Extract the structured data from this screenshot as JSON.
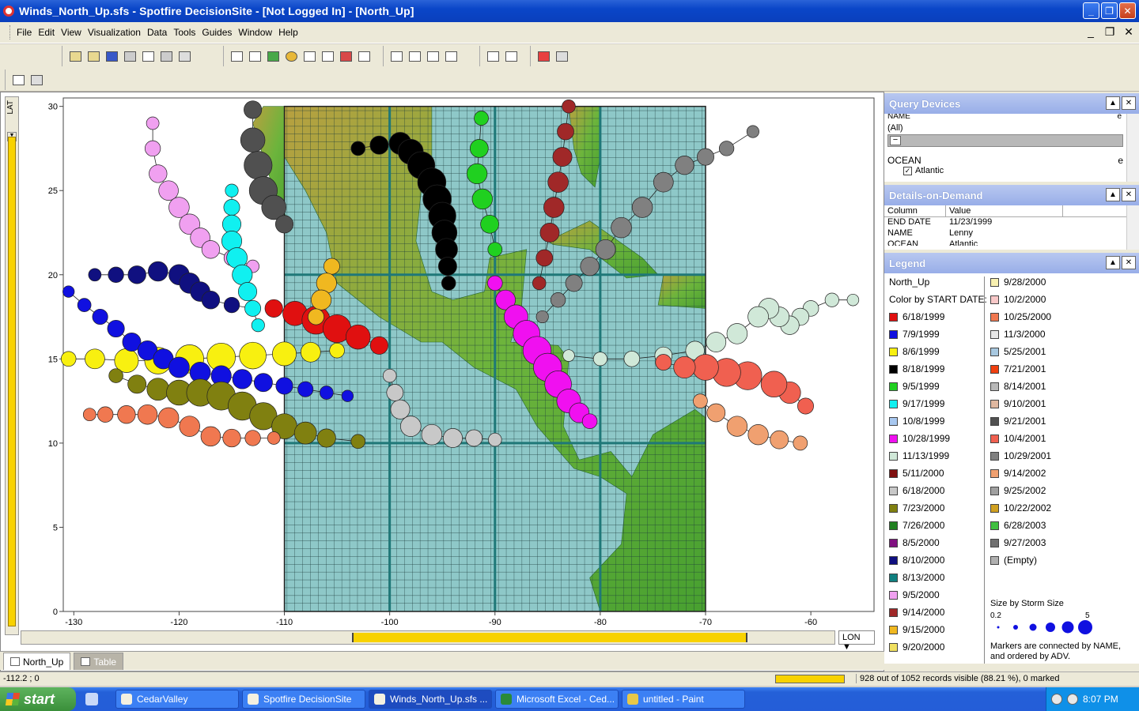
{
  "window": {
    "title": "Winds_North_Up.sfs - Spotfire DecisionSite - [Not Logged In] - [North_Up]",
    "minimize": "_",
    "maximize": "❐",
    "close": "✕"
  },
  "menu": [
    "File",
    "Edit",
    "View",
    "Visualization",
    "Data",
    "Tools",
    "Guides",
    "Window",
    "Help"
  ],
  "mdi": {
    "minimize": "_",
    "restore": "❐",
    "close": "✕"
  },
  "lat_label": "LAT",
  "lon_label": "LON ▼",
  "axes": {
    "x_ticks": [
      "-130",
      "-120",
      "-110",
      "-100",
      "-90",
      "-80",
      "-70",
      "-60"
    ],
    "y_ticks": [
      "30",
      "25",
      "20",
      "15",
      "10",
      "5",
      "0"
    ],
    "xlim": [
      -131,
      -54
    ],
    "ylim": [
      0,
      30.5
    ]
  },
  "tabs": [
    {
      "label": "North_Up",
      "active": true
    },
    {
      "label": "Table",
      "active": false
    }
  ],
  "query_devices": {
    "title": "Query Devices",
    "name_label": "NAME",
    "name_value": "(All)",
    "ocean_label": "OCEAN",
    "ocean_value": "Atlantic",
    "ocean_flag": "e",
    "name_flag": "e"
  },
  "details": {
    "title": "Details-on-Demand",
    "col_header": "Column",
    "val_header": "Value",
    "rows": [
      {
        "col": "END DATE",
        "val": "11/23/1999"
      },
      {
        "col": "NAME",
        "val": "Lenny"
      },
      {
        "col": "OCEAN",
        "val": "Atlantic"
      }
    ]
  },
  "legend": {
    "title": "Legend",
    "heading": "North_Up",
    "color_by": "Color by START DATE:",
    "col1": [
      {
        "label": "6/18/1999",
        "color": "#e01010"
      },
      {
        "label": "7/9/1999",
        "color": "#1010e0"
      },
      {
        "label": "8/6/1999",
        "color": "#f8f010"
      },
      {
        "label": "8/18/1999",
        "color": "#000000"
      },
      {
        "label": "9/5/1999",
        "color": "#20d020"
      },
      {
        "label": "9/17/1999",
        "color": "#10f0f0"
      },
      {
        "label": "10/8/1999",
        "color": "#a8c8f0"
      },
      {
        "label": "10/28/1999",
        "color": "#f010f0"
      },
      {
        "label": "11/13/1999",
        "color": "#d0e8d8"
      },
      {
        "label": "5/11/2000",
        "color": "#801010"
      },
      {
        "label": "6/18/2000",
        "color": "#c8c8c8"
      },
      {
        "label": "7/23/2000",
        "color": "#808010"
      },
      {
        "label": "7/26/2000",
        "color": "#208020"
      },
      {
        "label": "8/5/2000",
        "color": "#801080"
      },
      {
        "label": "8/10/2000",
        "color": "#101080"
      },
      {
        "label": "8/13/2000",
        "color": "#108080"
      },
      {
        "label": "9/5/2000",
        "color": "#f0a0f0"
      },
      {
        "label": "9/14/2000",
        "color": "#a02828"
      },
      {
        "label": "9/15/2000",
        "color": "#f0b820"
      },
      {
        "label": "9/20/2000",
        "color": "#f0e060"
      }
    ],
    "col2": [
      {
        "label": "9/28/2000",
        "color": "#f8f0b0"
      },
      {
        "label": "10/2/2000",
        "color": "#f8c8c8"
      },
      {
        "label": "10/25/2000",
        "color": "#f07850"
      },
      {
        "label": "11/3/2000",
        "color": "#e8e8e8"
      },
      {
        "label": "5/25/2001",
        "color": "#a8c8e0"
      },
      {
        "label": "7/21/2001",
        "color": "#f04010"
      },
      {
        "label": "8/14/2001",
        "color": "#b8b8b8"
      },
      {
        "label": "9/10/2001",
        "color": "#e0b8a0"
      },
      {
        "label": "9/21/2001",
        "color": "#505050"
      },
      {
        "label": "10/4/2001",
        "color": "#f06050"
      },
      {
        "label": "10/29/2001",
        "color": "#808080"
      },
      {
        "label": "9/14/2002",
        "color": "#f0a070"
      },
      {
        "label": "9/25/2002",
        "color": "#a0a0a0"
      },
      {
        "label": "10/22/2002",
        "color": "#d0a020"
      },
      {
        "label": "6/28/2003",
        "color": "#40c040"
      },
      {
        "label": "9/27/2003",
        "color": "#707070"
      },
      {
        "label": "(Empty)",
        "color": "#b0b0b0"
      }
    ],
    "size_by": "Size by Storm Size",
    "size_min": "0.2",
    "size_max": "5",
    "note": "Markers are connected by NAME, and ordered by ADV."
  },
  "status": {
    "coords": "-112.2 ; 0",
    "records": "928 out of 1052 records visible (88.21 %), 0 marked"
  },
  "taskbar": {
    "start": "start",
    "buttons": [
      "CedarValley",
      "Spotfire DecisionSite",
      "Winds_North_Up.sfs ...",
      "Microsoft Excel - Ced...",
      "untitled - Paint"
    ],
    "active_index": 2,
    "clock": "8:07 PM"
  },
  "chart_data": {
    "type": "scatter",
    "xlim": [
      -131,
      -54
    ],
    "ylim": [
      0,
      30.5
    ],
    "grid": false,
    "map_extent": {
      "lon": [
        -110,
        -70
      ],
      "lat": [
        0,
        30
      ]
    },
    "series": [
      {
        "color": "#f8f010",
        "points": [
          [
            -130.5,
            15
          ],
          [
            -128,
            15
          ],
          [
            -125,
            14.9
          ],
          [
            -122,
            14.9
          ],
          [
            -119,
            15
          ],
          [
            -116,
            15.1
          ],
          [
            -113,
            15.2
          ],
          [
            -110,
            15.3
          ],
          [
            -107.5,
            15.4
          ],
          [
            -105,
            15.5
          ]
        ]
      },
      {
        "color": "#1010e0",
        "points": [
          [
            -130.5,
            19
          ],
          [
            -129,
            18.2
          ],
          [
            -127.5,
            17.5
          ],
          [
            -126,
            16.8
          ],
          [
            -124.5,
            16
          ],
          [
            -123,
            15.5
          ],
          [
            -121.5,
            15
          ],
          [
            -120,
            14.5
          ],
          [
            -118,
            14.2
          ],
          [
            -116,
            14
          ],
          [
            -114,
            13.8
          ],
          [
            -112,
            13.6
          ],
          [
            -110,
            13.4
          ],
          [
            -108,
            13.2
          ],
          [
            -106,
            13
          ],
          [
            -104,
            12.8
          ]
        ]
      },
      {
        "color": "#101080",
        "points": [
          [
            -128,
            20
          ],
          [
            -126,
            20
          ],
          [
            -124,
            20
          ],
          [
            -122,
            20.2
          ],
          [
            -120,
            20
          ],
          [
            -119,
            19.5
          ],
          [
            -118,
            19
          ],
          [
            -117,
            18.5
          ],
          [
            -115,
            18.2
          ],
          [
            -113,
            18
          ]
        ]
      },
      {
        "color": "#808010",
        "points": [
          [
            -126,
            14
          ],
          [
            -124,
            13.5
          ],
          [
            -122,
            13.2
          ],
          [
            -120,
            13
          ],
          [
            -118,
            13
          ],
          [
            -116,
            12.8
          ],
          [
            -114,
            12.2
          ],
          [
            -112,
            11.6
          ],
          [
            -110,
            11
          ],
          [
            -108,
            10.6
          ],
          [
            -106,
            10.3
          ],
          [
            -103,
            10.1
          ]
        ]
      },
      {
        "color": "#f07850",
        "points": [
          [
            -128.5,
            11.7
          ],
          [
            -127,
            11.7
          ],
          [
            -125,
            11.7
          ],
          [
            -123,
            11.7
          ],
          [
            -121,
            11.5
          ],
          [
            -119,
            11
          ],
          [
            -117,
            10.4
          ],
          [
            -115,
            10.3
          ],
          [
            -113,
            10.3
          ],
          [
            -111,
            10.3
          ]
        ]
      },
      {
        "color": "#f0a0f0",
        "points": [
          [
            -122.5,
            29
          ],
          [
            -122.5,
            27.5
          ],
          [
            -122,
            26
          ],
          [
            -121,
            25
          ],
          [
            -120,
            24
          ],
          [
            -119,
            23
          ],
          [
            -118,
            22.2
          ],
          [
            -117,
            21.5
          ],
          [
            -115,
            21
          ],
          [
            -113,
            20.5
          ]
        ]
      },
      {
        "color": "#000000",
        "points": [
          [
            -103,
            27.5
          ],
          [
            -101,
            27.7
          ],
          [
            -99,
            27.8
          ],
          [
            -98,
            27.3
          ],
          [
            -97,
            26.5
          ],
          [
            -96,
            25.5
          ],
          [
            -95.5,
            24.5
          ],
          [
            -95,
            23.5
          ],
          [
            -94.8,
            22.5
          ],
          [
            -94.6,
            21.5
          ],
          [
            -94.5,
            20.5
          ],
          [
            -94.4,
            19.5
          ]
        ]
      },
      {
        "color": "#808080",
        "points": [
          [
            -65.5,
            28.5
          ],
          [
            -68,
            27.5
          ],
          [
            -70,
            27
          ],
          [
            -72,
            26.5
          ],
          [
            -74,
            25.5
          ],
          [
            -76,
            24
          ],
          [
            -78,
            22.8
          ],
          [
            -79.5,
            21.5
          ],
          [
            -81,
            20.5
          ],
          [
            -82.5,
            19.5
          ],
          [
            -84,
            18.5
          ],
          [
            -85.5,
            17.5
          ]
        ]
      },
      {
        "color": "#d0e8d8",
        "points": [
          [
            -56,
            18.5
          ],
          [
            -58,
            18.5
          ],
          [
            -60,
            18
          ],
          [
            -61,
            17.5
          ],
          [
            -62,
            17
          ],
          [
            -63,
            17.5
          ],
          [
            -64,
            18
          ],
          [
            -65,
            17.5
          ],
          [
            -67,
            16.5
          ],
          [
            -69,
            16
          ],
          [
            -71,
            15.5
          ],
          [
            -74,
            15.2
          ],
          [
            -77,
            15
          ],
          [
            -80,
            15
          ],
          [
            -83,
            15.2
          ]
        ]
      },
      {
        "color": "#f06050",
        "points": [
          [
            -60.5,
            12.2
          ],
          [
            -62,
            13
          ],
          [
            -63.5,
            13.5
          ],
          [
            -66,
            14
          ],
          [
            -68,
            14.2
          ],
          [
            -70,
            14.5
          ],
          [
            -72,
            14.5
          ],
          [
            -74,
            14.8
          ]
        ]
      },
      {
        "color": "#a02828",
        "points": [
          [
            -83,
            30
          ],
          [
            -83.3,
            28.5
          ],
          [
            -83.6,
            27
          ],
          [
            -84,
            25.5
          ],
          [
            -84.4,
            24
          ],
          [
            -84.8,
            22.5
          ],
          [
            -85.3,
            21
          ],
          [
            -85.8,
            19.5
          ]
        ]
      },
      {
        "color": "#20d020",
        "points": [
          [
            -91.3,
            29.3
          ],
          [
            -91.5,
            27.5
          ],
          [
            -91.7,
            26
          ],
          [
            -91.2,
            24.5
          ],
          [
            -90.5,
            23
          ],
          [
            -90,
            21.5
          ]
        ]
      },
      {
        "color": "#f010f0",
        "points": [
          [
            -90,
            19.5
          ],
          [
            -89,
            18.5
          ],
          [
            -88,
            17.5
          ],
          [
            -87,
            16.5
          ],
          [
            -86,
            15.5
          ],
          [
            -85,
            14.5
          ],
          [
            -84,
            13.5
          ],
          [
            -83,
            12.5
          ],
          [
            -82,
            11.8
          ],
          [
            -81,
            11.3
          ]
        ]
      },
      {
        "color": "#c8c8c8",
        "points": [
          [
            -90,
            10.2
          ],
          [
            -92,
            10.3
          ],
          [
            -94,
            10.3
          ],
          [
            -96,
            10.5
          ],
          [
            -98,
            11
          ],
          [
            -99,
            12
          ],
          [
            -99.5,
            13
          ],
          [
            -100,
            14
          ]
        ]
      },
      {
        "color": "#10f0f0",
        "points": [
          [
            -115,
            25
          ],
          [
            -115,
            24
          ],
          [
            -115,
            23
          ],
          [
            -115,
            22
          ],
          [
            -114.5,
            21
          ],
          [
            -114,
            20
          ],
          [
            -113.5,
            19
          ],
          [
            -113,
            18
          ],
          [
            -112.5,
            17
          ]
        ]
      },
      {
        "color": "#e01010",
        "points": [
          [
            -111,
            18
          ],
          [
            -109,
            17.7
          ],
          [
            -107,
            17.3
          ],
          [
            -105,
            16.8
          ],
          [
            -103,
            16.3
          ],
          [
            -101,
            15.8
          ]
        ]
      },
      {
        "color": "#f0a070",
        "points": [
          [
            -61,
            10
          ],
          [
            -63,
            10.2
          ],
          [
            -65,
            10.5
          ],
          [
            -67,
            11
          ],
          [
            -69,
            11.8
          ],
          [
            -70.5,
            12.5
          ]
        ]
      },
      {
        "color": "#f0b820",
        "points": [
          [
            -105.5,
            20.5
          ],
          [
            -106,
            19.5
          ],
          [
            -106.5,
            18.5
          ],
          [
            -107,
            17.5
          ]
        ]
      },
      {
        "color": "#505050",
        "points": [
          [
            -113,
            29.8
          ],
          [
            -113,
            28
          ],
          [
            -112.5,
            26.5
          ],
          [
            -112,
            25
          ],
          [
            -111,
            24
          ],
          [
            -110,
            23
          ]
        ]
      }
    ]
  }
}
